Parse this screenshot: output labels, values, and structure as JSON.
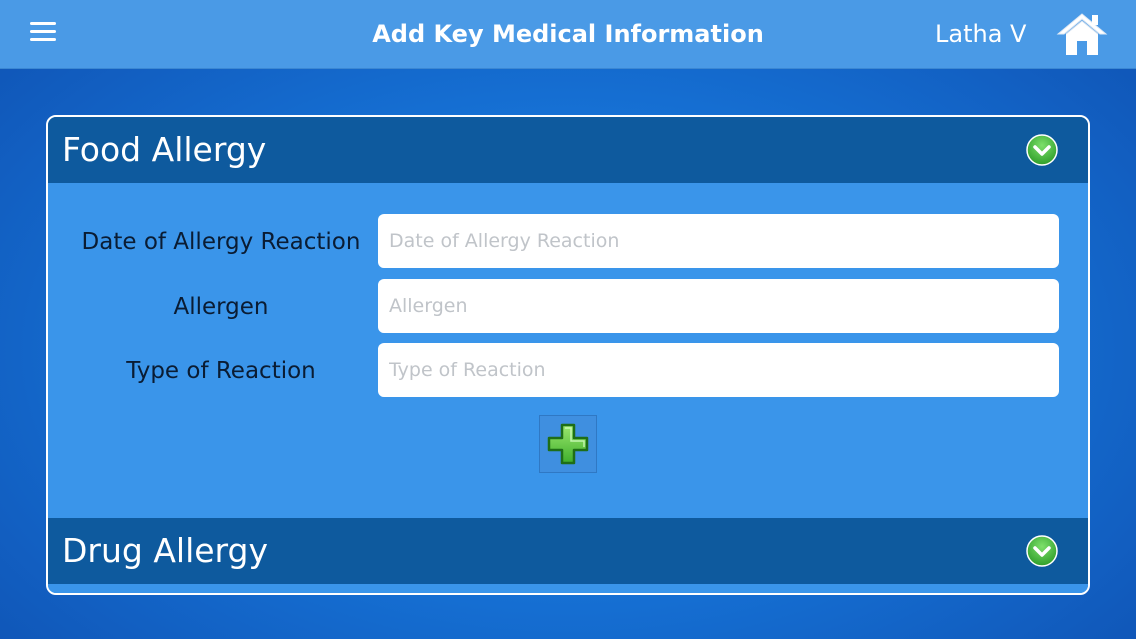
{
  "header": {
    "title": "Add Key Medical Information",
    "user_name": "Latha V",
    "menu_icon": "hamburger-menu-icon",
    "home_icon": "home-icon"
  },
  "food_allergy": {
    "title": "Food Allergy",
    "expand_icon": "chevron-down-icon",
    "fields": [
      {
        "label": "Date of Allergy Reaction",
        "value": "",
        "placeholder": "Date of Allergy Reaction"
      },
      {
        "label": "Allergen",
        "value": "",
        "placeholder": "Allergen"
      },
      {
        "label": "Type of Reaction",
        "value": "",
        "placeholder": "Type of Reaction"
      }
    ],
    "add_icon": "plus-icon"
  },
  "drug_allergy": {
    "title": "Drug Allergy",
    "expand_icon": "chevron-down-icon"
  },
  "colors": {
    "topbar": "#4a9ae6",
    "section_header": "#0e5a9e",
    "panel_body": "#3a95ea",
    "accent_green": "#3fbe3a"
  }
}
